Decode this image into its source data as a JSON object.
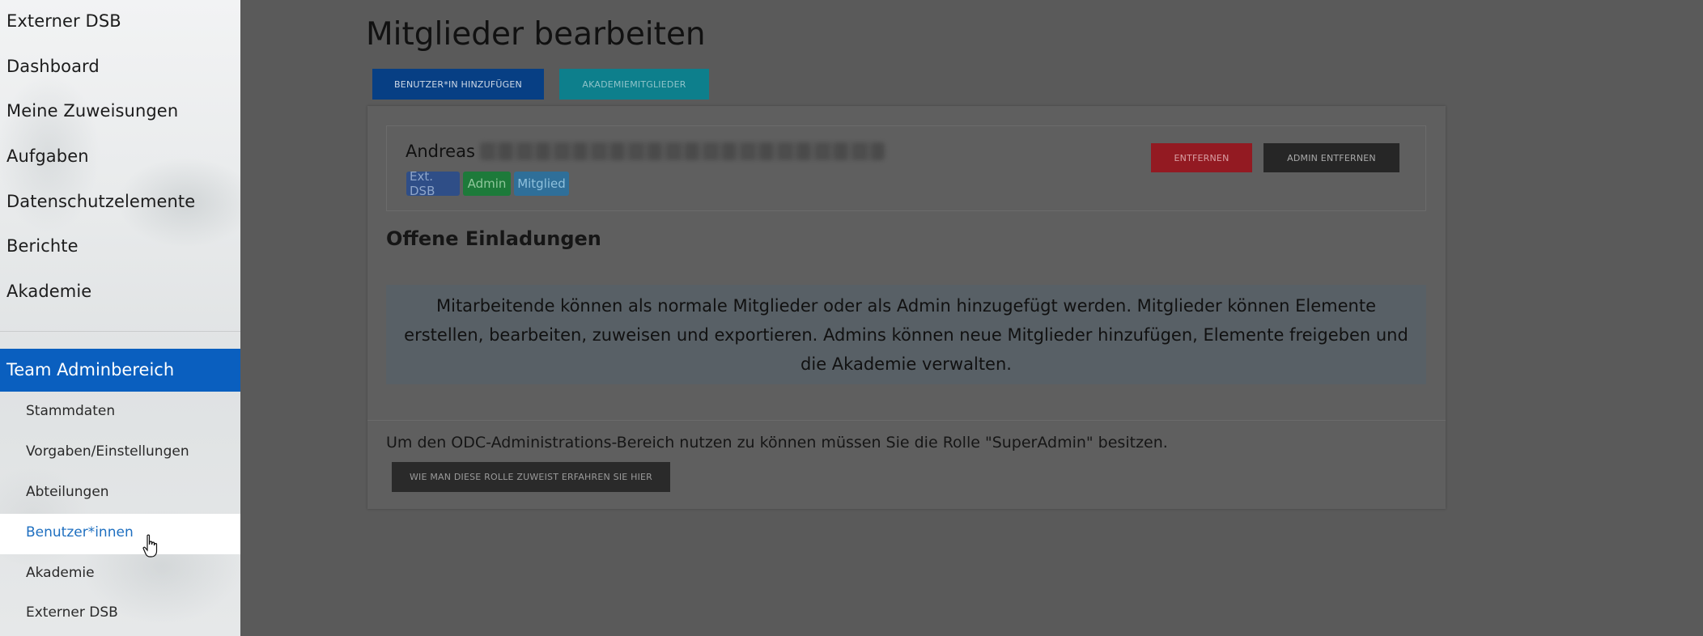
{
  "sidebar": {
    "items": [
      {
        "label": "Externer DSB"
      },
      {
        "label": "Dashboard"
      },
      {
        "label": "Meine Zuweisungen"
      },
      {
        "label": "Aufgaben"
      },
      {
        "label": "Datenschutzelemente"
      },
      {
        "label": "Berichte"
      },
      {
        "label": "Akademie"
      }
    ],
    "team_header": "Team Adminbereich",
    "sub_items": [
      {
        "label": "Stammdaten"
      },
      {
        "label": "Vorgaben/Einstellungen"
      },
      {
        "label": "Abteilungen"
      },
      {
        "label": "Benutzer*innen"
      },
      {
        "label": "Akademie"
      },
      {
        "label": "Externer DSB"
      }
    ],
    "active_sub_item": "Benutzer*innen",
    "active_color": "#1e6fc0",
    "header_color": "#0a5fbf"
  },
  "main": {
    "title": "Mitglieder bearbeiten",
    "buttons": {
      "add_user": "BENUTZER*IN HINZUFÜGEN",
      "academy_members": "AKADEMIEMITGLIEDER"
    },
    "member": {
      "first_name": "Andreas",
      "badges": [
        "Ext. DSB",
        "Admin",
        "Mitglied"
      ],
      "remove_label": "ENTFERNEN",
      "remove_admin_label": "ADMIN ENTFERNEN"
    },
    "invitations_title": "Offene Einladungen",
    "info_text": "Mitarbeitende können als normale Mitglieder oder als Admin hinzugefügt werden. Mitglieder können Elemente erstellen, bearbeiten, zuweisen und exportieren. Admins können neue Mitglieder hinzufügen, Elemente freigeben und die Akademie verwalten.",
    "footer_text": "Um den ODC-Administrations-Bereich nutzen zu können müssen Sie die Rolle \"SuperAdmin\" besitzen.",
    "role_button": "WIE MAN DIESE ROLLE ZUWEIST ERFAHREN SIE HIER"
  }
}
